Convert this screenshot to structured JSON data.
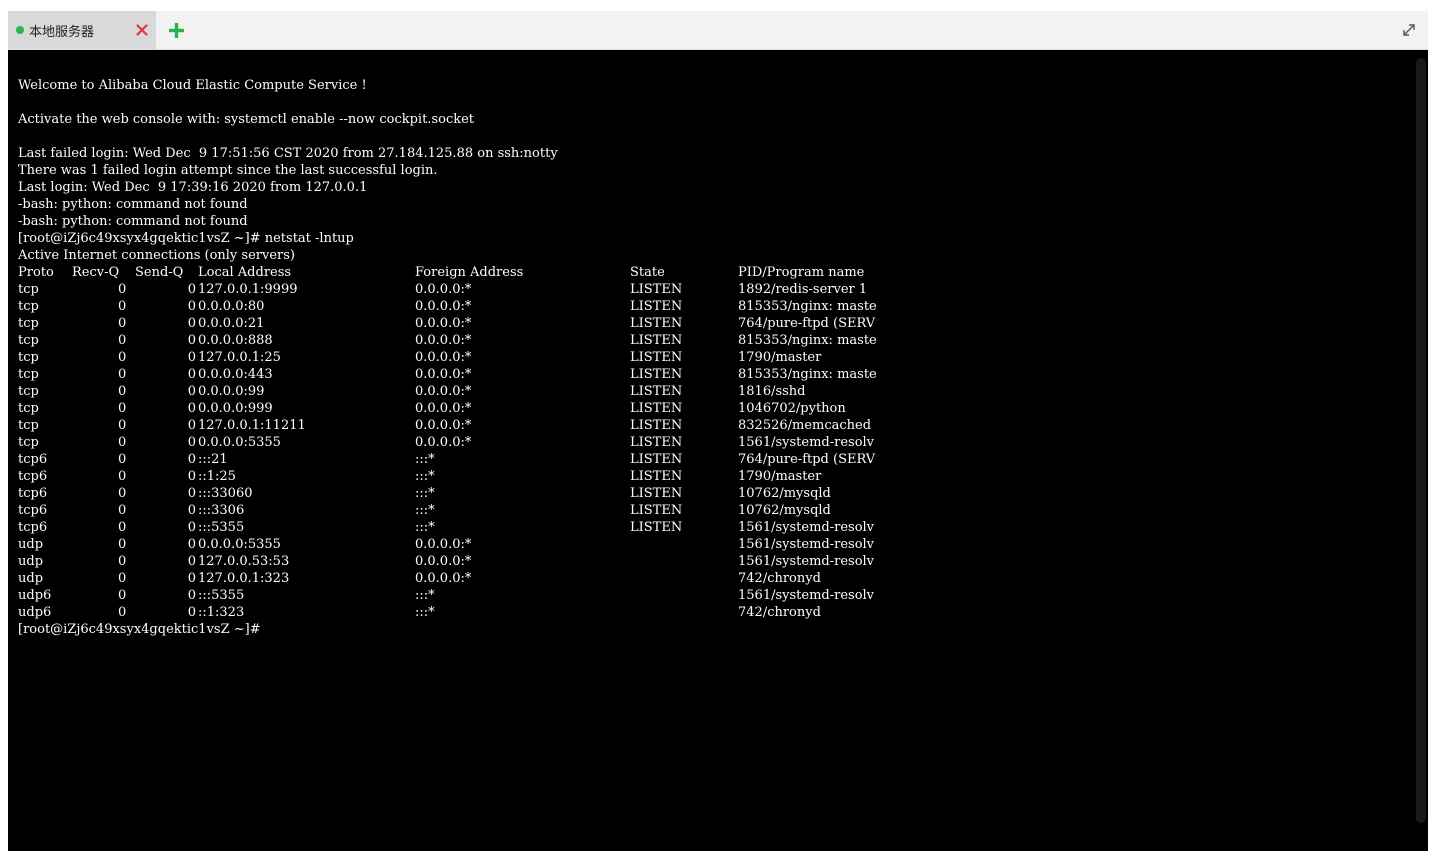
{
  "tab": {
    "label": "本地服务器",
    "status": "connected",
    "status_color": "#2bb24c",
    "close_icon": "close-icon",
    "close_color": "#e53935"
  },
  "add_tab_icon": "plus-icon",
  "add_tab_color": "#2bb24c",
  "expand_icon": "expand-icon",
  "terminal": {
    "intro": [
      "Welcome to Alibaba Cloud Elastic Compute Service !",
      "",
      "Activate the web console with: systemctl enable --now cockpit.socket",
      "",
      "Last failed login: Wed Dec  9 17:51:56 CST 2020 from 27.184.125.88 on ssh:notty",
      "There was 1 failed login attempt since the last successful login.",
      "Last login: Wed Dec  9 17:39:16 2020 from 127.0.0.1",
      "-bash: python: command not found",
      "-bash: python: command not found",
      "[root@iZj6c49xsyx4gqektic1vsZ ~]# netstat -lntup",
      "Active Internet connections (only servers)"
    ],
    "table_header": {
      "proto": "Proto",
      "recvq": "Recv-Q",
      "sendq": "Send-Q",
      "local": "Local Address",
      "foreign": "Foreign Address",
      "state": "State",
      "pid": "PID/Program name"
    },
    "rows": [
      {
        "proto": "tcp",
        "recvq": "0",
        "sendq": "0",
        "local": "127.0.0.1:9999",
        "foreign": "0.0.0.0:*",
        "state": "LISTEN",
        "pid": "1892/redis-server 1"
      },
      {
        "proto": "tcp",
        "recvq": "0",
        "sendq": "0",
        "local": "0.0.0.0:80",
        "foreign": "0.0.0.0:*",
        "state": "LISTEN",
        "pid": "815353/nginx: maste"
      },
      {
        "proto": "tcp",
        "recvq": "0",
        "sendq": "0",
        "local": "0.0.0.0:21",
        "foreign": "0.0.0.0:*",
        "state": "LISTEN",
        "pid": "764/pure-ftpd (SERV"
      },
      {
        "proto": "tcp",
        "recvq": "0",
        "sendq": "0",
        "local": "0.0.0.0:888",
        "foreign": "0.0.0.0:*",
        "state": "LISTEN",
        "pid": "815353/nginx: maste"
      },
      {
        "proto": "tcp",
        "recvq": "0",
        "sendq": "0",
        "local": "127.0.0.1:25",
        "foreign": "0.0.0.0:*",
        "state": "LISTEN",
        "pid": "1790/master"
      },
      {
        "proto": "tcp",
        "recvq": "0",
        "sendq": "0",
        "local": "0.0.0.0:443",
        "foreign": "0.0.0.0:*",
        "state": "LISTEN",
        "pid": "815353/nginx: maste"
      },
      {
        "proto": "tcp",
        "recvq": "0",
        "sendq": "0",
        "local": "0.0.0.0:99",
        "foreign": "0.0.0.0:*",
        "state": "LISTEN",
        "pid": "1816/sshd"
      },
      {
        "proto": "tcp",
        "recvq": "0",
        "sendq": "0",
        "local": "0.0.0.0:999",
        "foreign": "0.0.0.0:*",
        "state": "LISTEN",
        "pid": "1046702/python"
      },
      {
        "proto": "tcp",
        "recvq": "0",
        "sendq": "0",
        "local": "127.0.0.1:11211",
        "foreign": "0.0.0.0:*",
        "state": "LISTEN",
        "pid": "832526/memcached"
      },
      {
        "proto": "tcp",
        "recvq": "0",
        "sendq": "0",
        "local": "0.0.0.0:5355",
        "foreign": "0.0.0.0:*",
        "state": "LISTEN",
        "pid": "1561/systemd-resolv"
      },
      {
        "proto": "tcp6",
        "recvq": "0",
        "sendq": "0",
        "local": ":::21",
        "foreign": ":::*",
        "state": "LISTEN",
        "pid": "764/pure-ftpd (SERV"
      },
      {
        "proto": "tcp6",
        "recvq": "0",
        "sendq": "0",
        "local": "::1:25",
        "foreign": ":::*",
        "state": "LISTEN",
        "pid": "1790/master"
      },
      {
        "proto": "tcp6",
        "recvq": "0",
        "sendq": "0",
        "local": ":::33060",
        "foreign": ":::*",
        "state": "LISTEN",
        "pid": "10762/mysqld"
      },
      {
        "proto": "tcp6",
        "recvq": "0",
        "sendq": "0",
        "local": ":::3306",
        "foreign": ":::*",
        "state": "LISTEN",
        "pid": "10762/mysqld"
      },
      {
        "proto": "tcp6",
        "recvq": "0",
        "sendq": "0",
        "local": ":::5355",
        "foreign": ":::*",
        "state": "LISTEN",
        "pid": "1561/systemd-resolv"
      },
      {
        "proto": "udp",
        "recvq": "0",
        "sendq": "0",
        "local": "0.0.0.0:5355",
        "foreign": "0.0.0.0:*",
        "state": "",
        "pid": "1561/systemd-resolv"
      },
      {
        "proto": "udp",
        "recvq": "0",
        "sendq": "0",
        "local": "127.0.0.53:53",
        "foreign": "0.0.0.0:*",
        "state": "",
        "pid": "1561/systemd-resolv"
      },
      {
        "proto": "udp",
        "recvq": "0",
        "sendq": "0",
        "local": "127.0.0.1:323",
        "foreign": "0.0.0.0:*",
        "state": "",
        "pid": "742/chronyd"
      },
      {
        "proto": "udp6",
        "recvq": "0",
        "sendq": "0",
        "local": ":::5355",
        "foreign": ":::*",
        "state": "",
        "pid": "1561/systemd-resolv"
      },
      {
        "proto": "udp6",
        "recvq": "0",
        "sendq": "0",
        "local": "::1:323",
        "foreign": ":::*",
        "state": "",
        "pid": "742/chronyd"
      }
    ],
    "prompt": "[root@iZj6c49xsyx4gqektic1vsZ ~]#"
  }
}
